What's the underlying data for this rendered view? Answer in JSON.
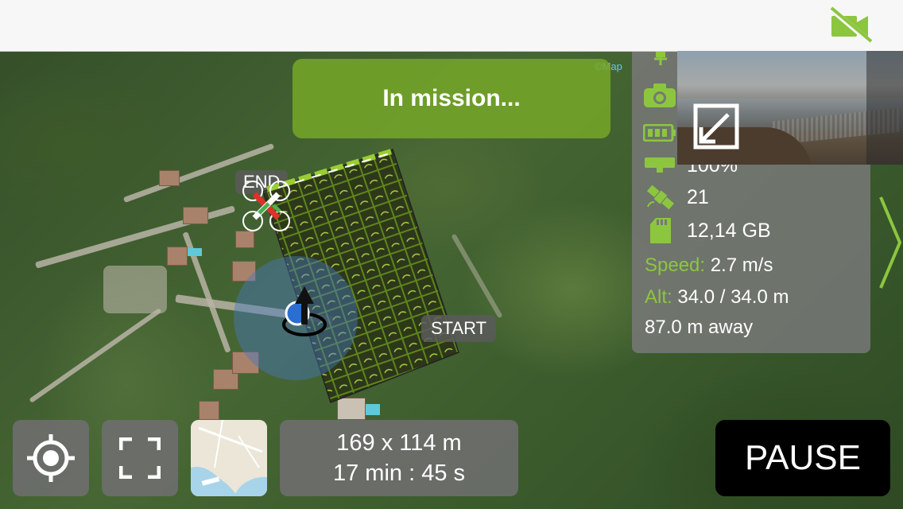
{
  "banner": {
    "status": "In mission..."
  },
  "map": {
    "attribution": "©Map",
    "start_label": "START",
    "end_label": "END"
  },
  "telemetry": {
    "battery_percent": "100%",
    "satellites": "21",
    "storage": "12,14 GB",
    "speed_label": "Speed:",
    "speed_value": "2.7 m/s",
    "alt_label": "Alt:",
    "alt_value": "34.0 / 34.0 m",
    "distance": "87.0 m away"
  },
  "survey": {
    "dimensions": "169 x 114 m",
    "duration": "17 min : 45 s"
  },
  "controls": {
    "pause_label": "PAUSE"
  },
  "icons": {
    "camera_status": "video-off-icon",
    "locate": "locate-icon",
    "fullscreen": "fullscreen-icon",
    "map_type": "map-type-icon",
    "expand_video": "expand-icon",
    "panel_toggle": "chevron-right-icon"
  },
  "colors": {
    "accent_green": "#8cc63f",
    "banner_green": "#78aa28",
    "panel_gray": "#787878"
  }
}
